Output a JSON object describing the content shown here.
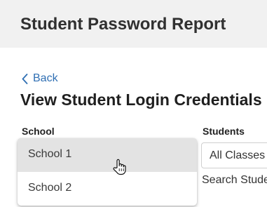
{
  "header": {
    "title": "Student Password Report"
  },
  "nav": {
    "back_label": "Back"
  },
  "page": {
    "title": "View Student Login Credentials"
  },
  "filters": {
    "school_label": "School",
    "students_label": "Students",
    "students_value": "All Classes",
    "search_students_label": "Search Stude"
  },
  "school_dropdown": {
    "options": [
      {
        "label": "School 1",
        "hovered": true
      },
      {
        "label": "School 2",
        "hovered": false
      }
    ]
  },
  "colors": {
    "header_bg": "#f1f1f1",
    "link": "#2f6fb3",
    "option_hover": "#e3e3e3"
  },
  "icons": {
    "back": "chevron-left-icon",
    "cursor": "hand-pointer-icon"
  }
}
